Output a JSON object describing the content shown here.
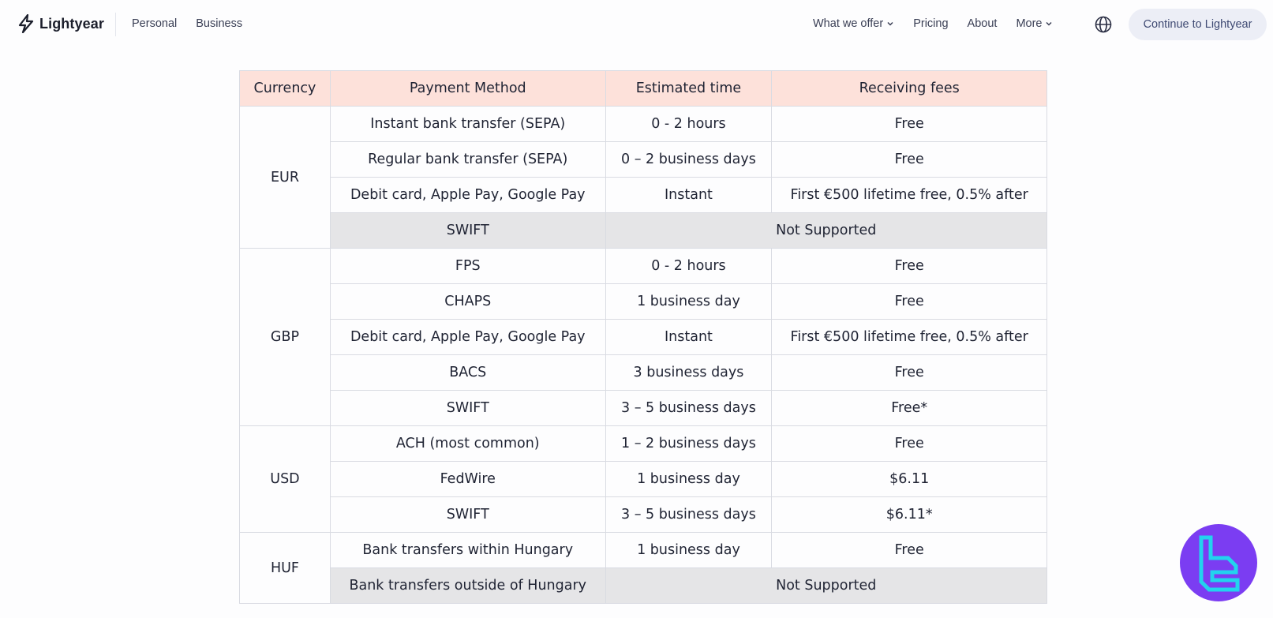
{
  "header": {
    "logo_text": "Lightyear",
    "nav_left": [
      "Personal",
      "Business"
    ],
    "nav_right": [
      "What we offer",
      "Pricing",
      "About",
      "More"
    ],
    "cta_label": "Continue to Lightyear",
    "icons": {
      "logo": "lightning-bolt-icon",
      "globe": "globe-icon",
      "chevron": "chevron-down-icon"
    }
  },
  "table": {
    "headers": [
      "Currency",
      "Payment Method",
      "Estimated time",
      "Receiving fees"
    ],
    "groups": [
      {
        "currency": "EUR",
        "rows": [
          {
            "method": "Instant bank transfer (SEPA)",
            "time": "0 - 2 hours",
            "fee": "Free"
          },
          {
            "method": "Regular bank transfer (SEPA)",
            "time": "0 – 2 business days",
            "fee": "Free"
          },
          {
            "method": "Debit card, Apple Pay, Google Pay",
            "time": "Instant",
            "fee": "First €500 lifetime free, 0.5% after"
          },
          {
            "method": "SWIFT",
            "merged": "Not Supported"
          }
        ]
      },
      {
        "currency": "GBP",
        "rows": [
          {
            "method": "FPS",
            "time": "0 - 2 hours",
            "fee": "Free"
          },
          {
            "method": "CHAPS",
            "time": "1 business day",
            "fee": "Free"
          },
          {
            "method": "Debit card, Apple Pay, Google Pay",
            "time": "Instant",
            "fee": "First €500 lifetime free, 0.5% after"
          },
          {
            "method": "BACS",
            "time": "3 business days",
            "fee": "Free"
          },
          {
            "method": "SWIFT",
            "time": "3 – 5 business days",
            "fee": "Free*"
          }
        ]
      },
      {
        "currency": "USD",
        "rows": [
          {
            "method": "ACH (most common)",
            "time": "1 – 2 business days",
            "fee": "Free"
          },
          {
            "method": "FedWire",
            "time": "1 business day",
            "fee": "$6.11"
          },
          {
            "method": "SWIFT",
            "time": "3 – 5 business days",
            "fee": "$6.11*"
          }
        ]
      },
      {
        "currency": "HUF",
        "rows": [
          {
            "method": "Bank transfers within Hungary",
            "time": "1 business day",
            "fee": "Free"
          },
          {
            "method": "Bank transfers outside of Hungary",
            "merged": "Not Supported"
          }
        ]
      }
    ]
  },
  "colors": {
    "header_row": "#fde1da",
    "not_supported_bg": "#e5e5e7",
    "cta_bg": "#eceef6",
    "badge_purple": "#7b3df2",
    "badge_cyan": "#22d3ee"
  },
  "badge": {
    "icon": "tradingfinder-logo-icon"
  }
}
